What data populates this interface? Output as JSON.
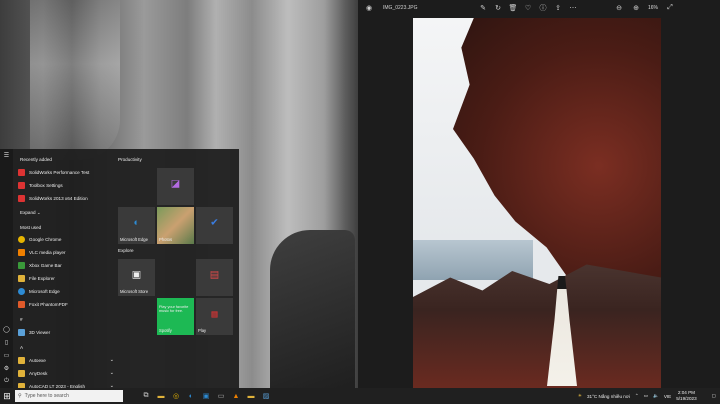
{
  "photos": {
    "title": "IMG_0223.JPG",
    "zoom": "16%"
  },
  "start": {
    "recently_added_label": "Recently added",
    "recent": [
      {
        "label": "SolidWorks Performance Test",
        "color": "#d33"
      },
      {
        "label": "Toolbox Settings",
        "color": "#d33"
      },
      {
        "label": "SolidWorks 2013 x64 Edition",
        "color": "#d33"
      }
    ],
    "expand_label": "Expand",
    "most_used_label": "Most used",
    "most_used": [
      {
        "label": "Google Chrome",
        "color": "#e6b400"
      },
      {
        "label": "VLC media player",
        "color": "#f08000"
      },
      {
        "label": "Xbox Game Bar",
        "color": "#3a9a3a"
      },
      {
        "label": "File Explorer",
        "color": "#e0b23a"
      },
      {
        "label": "Microsoft Edge",
        "color": "#2d8bd4"
      },
      {
        "label": "Foxit PhantomPDF",
        "color": "#e05a2a"
      }
    ],
    "hash_label": "#",
    "three_d": "3D Viewer",
    "a_label": "A",
    "folders": [
      "Autoexe",
      "AnyDesk",
      "AutoCAD LT 2023 - English"
    ],
    "productivity": "Productivity",
    "explore": "Explore",
    "tiles": {
      "edge": "Microsoft Edge",
      "photos": "Photos",
      "store": "Microsoft Store",
      "spotify_text": "Play your favorite music for free.",
      "spotify": "Spotify",
      "play": "Play"
    }
  },
  "taskbar": {
    "search_placeholder": "Type here to search",
    "weather": "31°C  Nắng nhiều nơi",
    "lang": "VIE",
    "time": "2:04 PM",
    "date": "5/19/2023"
  }
}
